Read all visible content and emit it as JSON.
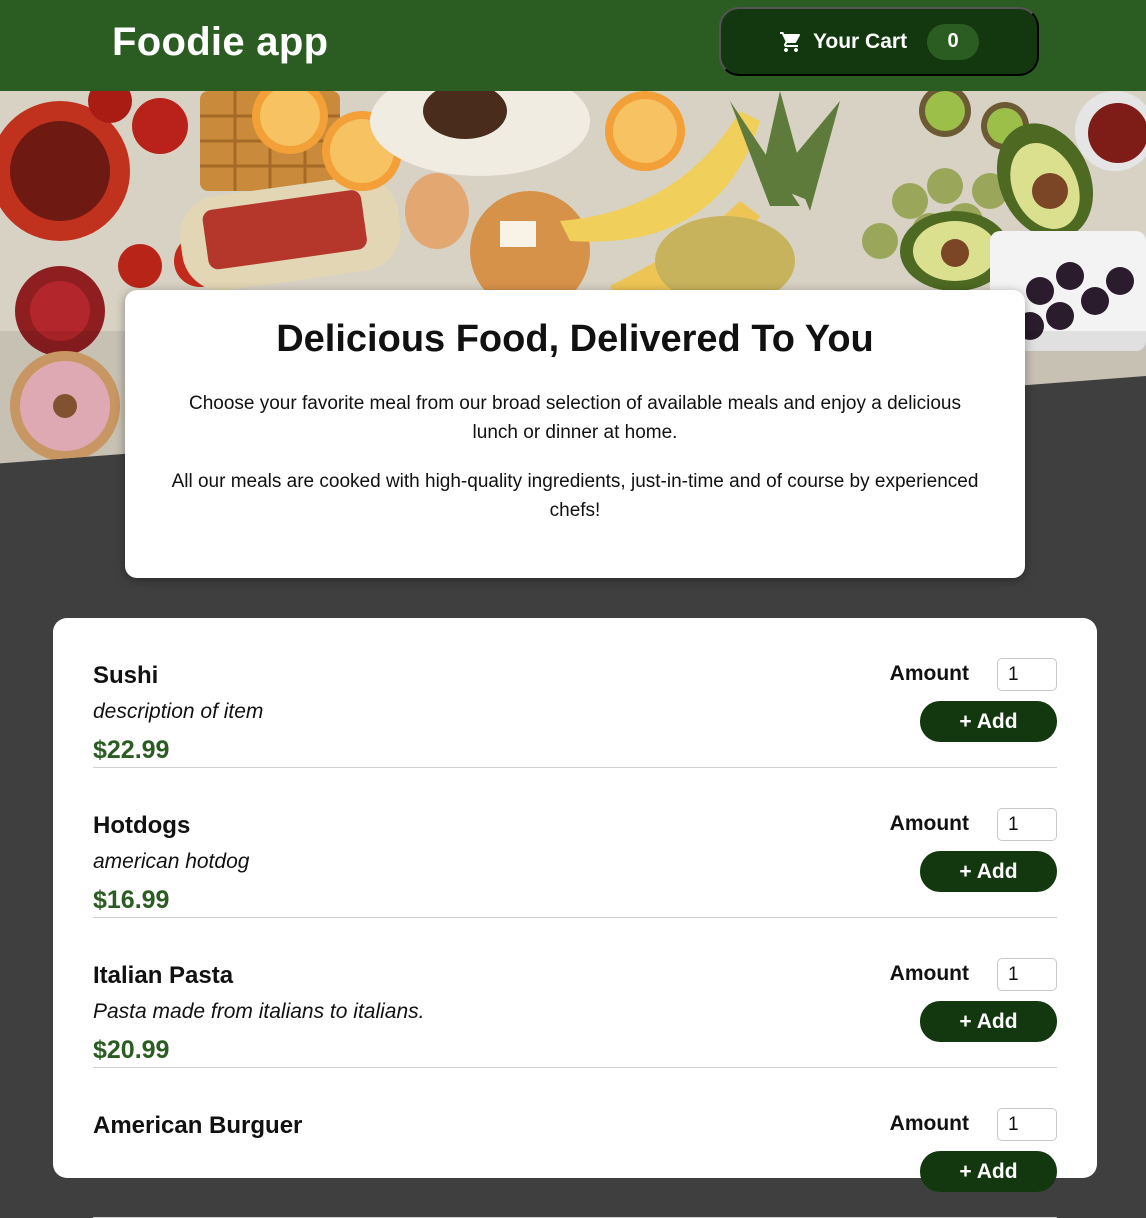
{
  "header": {
    "app_title": "Foodie app",
    "cart": {
      "label": "Your Cart",
      "count": "0",
      "icon": "cart-icon"
    }
  },
  "hero": {
    "image_alt": ""
  },
  "summary": {
    "title": "Delicious Food, Delivered To You",
    "paragraph1": "Choose your favorite meal from our broad selection of available meals and enjoy a delicious lunch or dinner at home.",
    "paragraph2": "All our meals are cooked with high-quality ingredients, just-in-time and of course by experienced chefs!"
  },
  "meals": [
    {
      "name": "Sushi",
      "description": "description of item",
      "price": "$22.99",
      "amount_label": "Amount",
      "amount_value": "1",
      "add_label": "+ Add"
    },
    {
      "name": "Hotdogs",
      "description": "american hotdog",
      "price": "$16.99",
      "amount_label": "Amount",
      "amount_value": "1",
      "add_label": "+ Add"
    },
    {
      "name": "Italian Pasta",
      "description": "Pasta made from italians to italians.",
      "price": "$20.99",
      "amount_label": "Amount",
      "amount_value": "1",
      "add_label": "+ Add"
    },
    {
      "name": "American Burguer",
      "description": "",
      "price": "",
      "amount_label": "Amount",
      "amount_value": "1",
      "add_label": "+ Add"
    }
  ],
  "colors": {
    "header_bg": "#2b5d22",
    "dark_green": "#13380f",
    "price": "#2b5d22",
    "page_bg": "#3f3f3f"
  }
}
